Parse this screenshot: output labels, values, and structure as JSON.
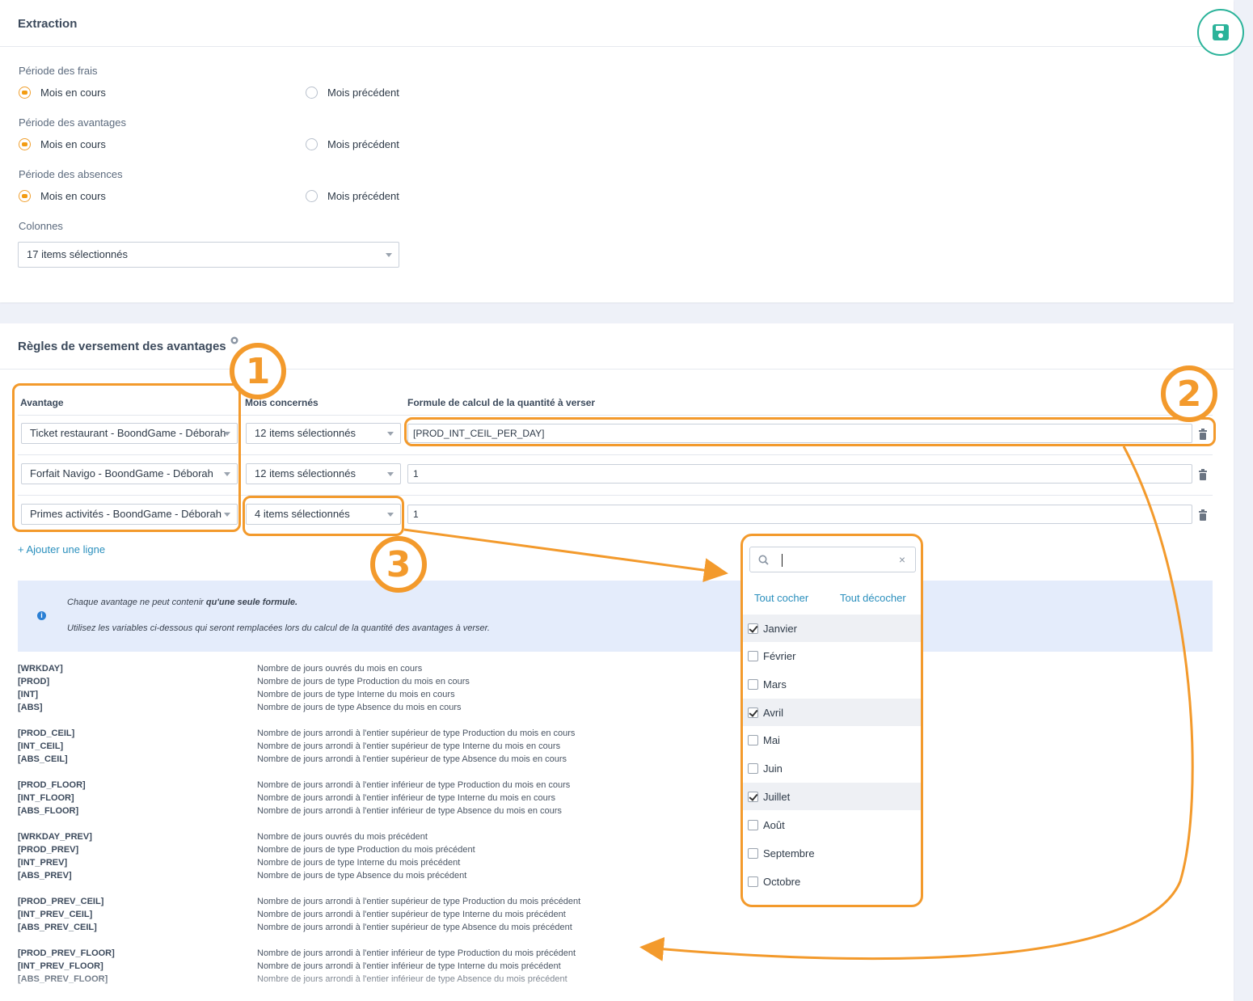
{
  "extraction": {
    "title": "Extraction",
    "periode_frais": {
      "label": "Période des frais",
      "option_current": "Mois en cours",
      "option_previous": "Mois précédent",
      "selected": "current"
    },
    "periode_avantages": {
      "label": "Période des avantages",
      "option_current": "Mois en cours",
      "option_previous": "Mois précédent",
      "selected": "current"
    },
    "periode_absences": {
      "label": "Période des absences",
      "option_current": "Mois en cours",
      "option_previous": "Mois précédent",
      "selected": "current"
    },
    "colonnes": {
      "label": "Colonnes",
      "value": "17 items sélectionnés"
    }
  },
  "regles": {
    "title": "Règles de versement des avantages",
    "columns": {
      "avantage": "Avantage",
      "mois": "Mois concernés",
      "formule": "Formule de calcul de la quantité à verser"
    },
    "rows": [
      {
        "avantage": "Ticket restaurant - BoondGame - Déborah",
        "mois": "12 items sélectionnés",
        "formule": "[PROD_INT_CEIL_PER_DAY]"
      },
      {
        "avantage": "Forfait Navigo - BoondGame - Déborah",
        "mois": "12 items sélectionnés",
        "formule": "1"
      },
      {
        "avantage": "Primes activités - BoondGame - Déborah",
        "mois": "4 items sélectionnés",
        "formule": "1"
      }
    ],
    "add_line": "+ Ajouter une ligne",
    "info": {
      "line1_pre": "Chaque avantage ne peut contenir ",
      "line1_bold": "qu'une seule formule.",
      "line2": "Utilisez les variables ci-dessous qui seront remplacées lors du calcul de la quantité des avantages à verser."
    },
    "variables": [
      {
        "name": "[WRKDAY]",
        "desc": "Nombre de jours ouvrés du mois en cours"
      },
      {
        "name": "[PROD]",
        "desc": "Nombre de jours de type Production du mois en cours"
      },
      {
        "name": "[INT]",
        "desc": "Nombre de jours de type Interne du mois en cours"
      },
      {
        "name": "[ABS]",
        "desc": "Nombre de jours de type Absence du mois en cours"
      },
      {
        "name": "[PROD_CEIL]",
        "desc": "Nombre de jours arrondi à l'entier supérieur de type Production du mois en cours"
      },
      {
        "name": "[INT_CEIL]",
        "desc": "Nombre de jours arrondi à l'entier supérieur de type Interne du mois en cours"
      },
      {
        "name": "[ABS_CEIL]",
        "desc": "Nombre de jours arrondi à l'entier supérieur de type Absence du mois en cours"
      },
      {
        "name": "[PROD_FLOOR]",
        "desc": "Nombre de jours arrondi à l'entier inférieur de type Production du mois en cours"
      },
      {
        "name": "[INT_FLOOR]",
        "desc": "Nombre de jours arrondi à l'entier inférieur de type Interne du mois en cours"
      },
      {
        "name": "[ABS_FLOOR]",
        "desc": "Nombre de jours arrondi à l'entier inférieur de type Absence du mois en cours"
      },
      {
        "name": "[WRKDAY_PREV]",
        "desc": "Nombre de jours ouvrés du mois précédent"
      },
      {
        "name": "[PROD_PREV]",
        "desc": "Nombre de jours de type Production du mois précédent"
      },
      {
        "name": "[INT_PREV]",
        "desc": "Nombre de jours de type Interne du mois précédent"
      },
      {
        "name": "[ABS_PREV]",
        "desc": "Nombre de jours de type Absence du mois précédent"
      },
      {
        "name": "[PROD_PREV_CEIL]",
        "desc": "Nombre de jours arrondi à l'entier supérieur de type Production du mois précédent"
      },
      {
        "name": "[INT_PREV_CEIL]",
        "desc": "Nombre de jours arrondi à l'entier supérieur de type Interne du mois précédent"
      },
      {
        "name": "[ABS_PREV_CEIL]",
        "desc": "Nombre de jours arrondi à l'entier supérieur de type Absence du mois précédent"
      },
      {
        "name": "[PROD_PREV_FLOOR]",
        "desc": "Nombre de jours arrondi à l'entier inférieur de type Production du mois précédent"
      },
      {
        "name": "[INT_PREV_FLOOR]",
        "desc": "Nombre de jours arrondi à l'entier inférieur de type Interne du mois précédent"
      },
      {
        "name": "[ABS_PREV_FLOOR]",
        "desc": "Nombre de jours arrondi à l'entier inférieur de type Absence du mois précédent"
      }
    ]
  },
  "dropdown": {
    "search_value": "",
    "select_all": "Tout cocher",
    "deselect_all": "Tout décocher",
    "clear_icon": "×",
    "months": [
      {
        "label": "Janvier",
        "checked": true
      },
      {
        "label": "Février",
        "checked": false
      },
      {
        "label": "Mars",
        "checked": false
      },
      {
        "label": "Avril",
        "checked": true
      },
      {
        "label": "Mai",
        "checked": false
      },
      {
        "label": "Juin",
        "checked": false
      },
      {
        "label": "Juillet",
        "checked": true
      },
      {
        "label": "Août",
        "checked": false
      },
      {
        "label": "Septembre",
        "checked": false
      },
      {
        "label": "Octobre",
        "checked": false
      }
    ]
  },
  "annotations": {
    "badges": [
      "1",
      "2",
      "3"
    ],
    "color": "#f39a2c"
  },
  "icons": {
    "save": "floppy-disk-icon",
    "trash": "trash-icon",
    "search": "search-icon",
    "info": "info-icon"
  },
  "colors": {
    "accent": "#2bb39a",
    "link": "#2a8fbd",
    "radio_on": "#f39c12",
    "info_bg": "#e4ecfb"
  }
}
